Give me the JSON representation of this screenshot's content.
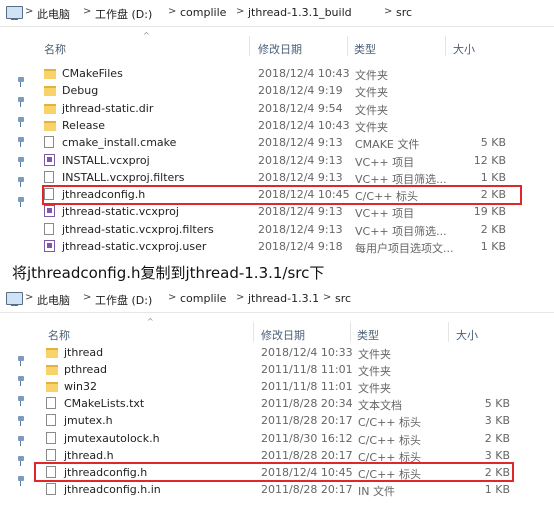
{
  "panel1": {
    "breadcrumb": [
      "此电脑",
      "工作盘 (D:)",
      "complile",
      "jthread-1.3.1_build",
      "src"
    ],
    "columns": {
      "name": "名称",
      "date": "修改日期",
      "type": "类型",
      "size": "大小"
    },
    "rows": [
      {
        "name": "CMakeFiles",
        "date": "2018/12/4 10:43",
        "type": "文件夹",
        "size": "",
        "icon": "folder-icon"
      },
      {
        "name": "Debug",
        "date": "2018/12/4 9:19",
        "type": "文件夹",
        "size": "",
        "icon": "folder-icon"
      },
      {
        "name": "jthread-static.dir",
        "date": "2018/12/4 9:54",
        "type": "文件夹",
        "size": "",
        "icon": "folder-icon"
      },
      {
        "name": "Release",
        "date": "2018/12/4 10:43",
        "type": "文件夹",
        "size": "",
        "icon": "folder-icon"
      },
      {
        "name": "cmake_install.cmake",
        "date": "2018/12/4 9:13",
        "type": "CMAKE 文件",
        "size": "5 KB",
        "icon": "file-icon"
      },
      {
        "name": "INSTALL.vcxproj",
        "date": "2018/12/4 9:13",
        "type": "VC++ 项目",
        "size": "12 KB",
        "icon": "vcxproj-icon"
      },
      {
        "name": "INSTALL.vcxproj.filters",
        "date": "2018/12/4 9:13",
        "type": "VC++ 项目筛选...",
        "size": "1 KB",
        "icon": "file-icon"
      },
      {
        "name": "jthreadconfig.h",
        "date": "2018/12/4 10:45",
        "type": "C/C++ 标头",
        "size": "2 KB",
        "icon": "header-file-icon"
      },
      {
        "name": "jthread-static.vcxproj",
        "date": "2018/12/4 9:13",
        "type": "VC++ 项目",
        "size": "19 KB",
        "icon": "vcxproj-icon"
      },
      {
        "name": "jthread-static.vcxproj.filters",
        "date": "2018/12/4 9:13",
        "type": "VC++ 项目筛选...",
        "size": "2 KB",
        "icon": "file-icon"
      },
      {
        "name": "jthread-static.vcxproj.user",
        "date": "2018/12/4 9:18",
        "type": "每用户项目选项文...",
        "size": "1 KB",
        "icon": "vcxproj-icon"
      }
    ]
  },
  "caption": "将jthreadconfig.h复制到jthread-1.3.1/src下",
  "panel2": {
    "breadcrumb": [
      "此电脑",
      "工作盘 (D:)",
      "complile",
      "jthread-1.3.1",
      "src"
    ],
    "columns": {
      "name": "名称",
      "date": "修改日期",
      "type": "类型",
      "size": "大小"
    },
    "rows": [
      {
        "name": "jthread",
        "date": "2018/12/4 10:33",
        "type": "文件夹",
        "size": "",
        "icon": "folder-icon"
      },
      {
        "name": "pthread",
        "date": "2011/11/8 11:01",
        "type": "文件夹",
        "size": "",
        "icon": "folder-icon"
      },
      {
        "name": "win32",
        "date": "2011/11/8 11:01",
        "type": "文件夹",
        "size": "",
        "icon": "folder-icon"
      },
      {
        "name": "CMakeLists.txt",
        "date": "2011/8/28 20:34",
        "type": "文本文档",
        "size": "5 KB",
        "icon": "file-icon"
      },
      {
        "name": "jmutex.h",
        "date": "2011/8/28 20:17",
        "type": "C/C++ 标头",
        "size": "3 KB",
        "icon": "header-file-icon"
      },
      {
        "name": "jmutexautolock.h",
        "date": "2011/8/30 16:12",
        "type": "C/C++ 标头",
        "size": "2 KB",
        "icon": "header-file-icon"
      },
      {
        "name": "jthread.h",
        "date": "2011/8/28 20:17",
        "type": "C/C++ 标头",
        "size": "3 KB",
        "icon": "header-file-icon"
      },
      {
        "name": "jthreadconfig.h",
        "date": "2018/12/4 10:45",
        "type": "C/C++ 标头",
        "size": "2 KB",
        "icon": "header-file-icon"
      },
      {
        "name": "jthreadconfig.h.in",
        "date": "2011/8/28 20:17",
        "type": "IN 文件",
        "size": "1 KB",
        "icon": "file-icon"
      }
    ]
  }
}
